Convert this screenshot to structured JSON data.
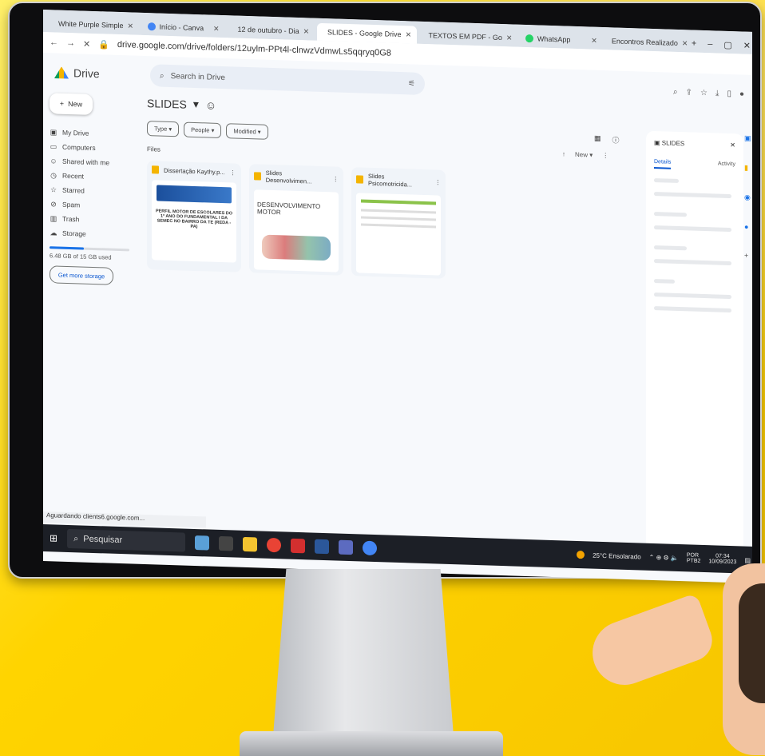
{
  "browser": {
    "tabs": [
      {
        "label": "White Purple Simple"
      },
      {
        "label": "Início - Canva"
      },
      {
        "label": "12 de outubro - Dia"
      },
      {
        "label": "SLIDES - Google Drive",
        "active": true
      },
      {
        "label": "TEXTOS EM PDF - Go"
      },
      {
        "label": "WhatsApp"
      },
      {
        "label": "Encontros Realizado"
      }
    ],
    "url": "drive.google.com/drive/folders/12uylm-PPt4l-clnwzVdmwLs5qqryq0G8"
  },
  "drive": {
    "logo_label": "Drive",
    "search_placeholder": "Search in Drive",
    "new_label": "New",
    "sidebar": [
      {
        "icon": "drive-icon",
        "label": "My Drive"
      },
      {
        "icon": "computer-icon",
        "label": "Computers"
      },
      {
        "icon": "people-icon",
        "label": "Shared with me"
      },
      {
        "icon": "clock-icon",
        "label": "Recent"
      },
      {
        "icon": "star-icon",
        "label": "Starred"
      },
      {
        "icon": "spam-icon",
        "label": "Spam"
      },
      {
        "icon": "trash-icon",
        "label": "Trash"
      },
      {
        "icon": "cloud-icon",
        "label": "Storage"
      }
    ],
    "storage_text": "6.48 GB of 15 GB used",
    "storage_fraction": 0.43,
    "get_storage": "Get more storage",
    "folder_title": "SLIDES",
    "filters": [
      "Type",
      "People",
      "Modified"
    ],
    "files_label": "Files",
    "new_menu": "New",
    "files": [
      {
        "name": "Dissertação Kaythy.p...",
        "thumb": "PERFIL MOTOR DE ESCOLARES DO 1º ANO DO FUNDAMENTAL I DA SEMEC NO BAIRRO DA TE (REDA - PA)"
      },
      {
        "name": "Slides Desenvolvimen...",
        "thumb": "DESENVOLVIMENTO MOTOR"
      },
      {
        "name": "Slides Psicomotricida...",
        "thumb": ""
      }
    ],
    "details": {
      "title": "SLIDES",
      "tab_details": "Details",
      "tab_activity": "Activity"
    }
  },
  "status": "Aguardando clients6.google.com...",
  "taskbar": {
    "search": "Pesquisar",
    "weather": "25°C Ensolarado",
    "lang": "POR",
    "lang2": "PTB2",
    "time": "07:34",
    "date": "10/09/2023"
  }
}
